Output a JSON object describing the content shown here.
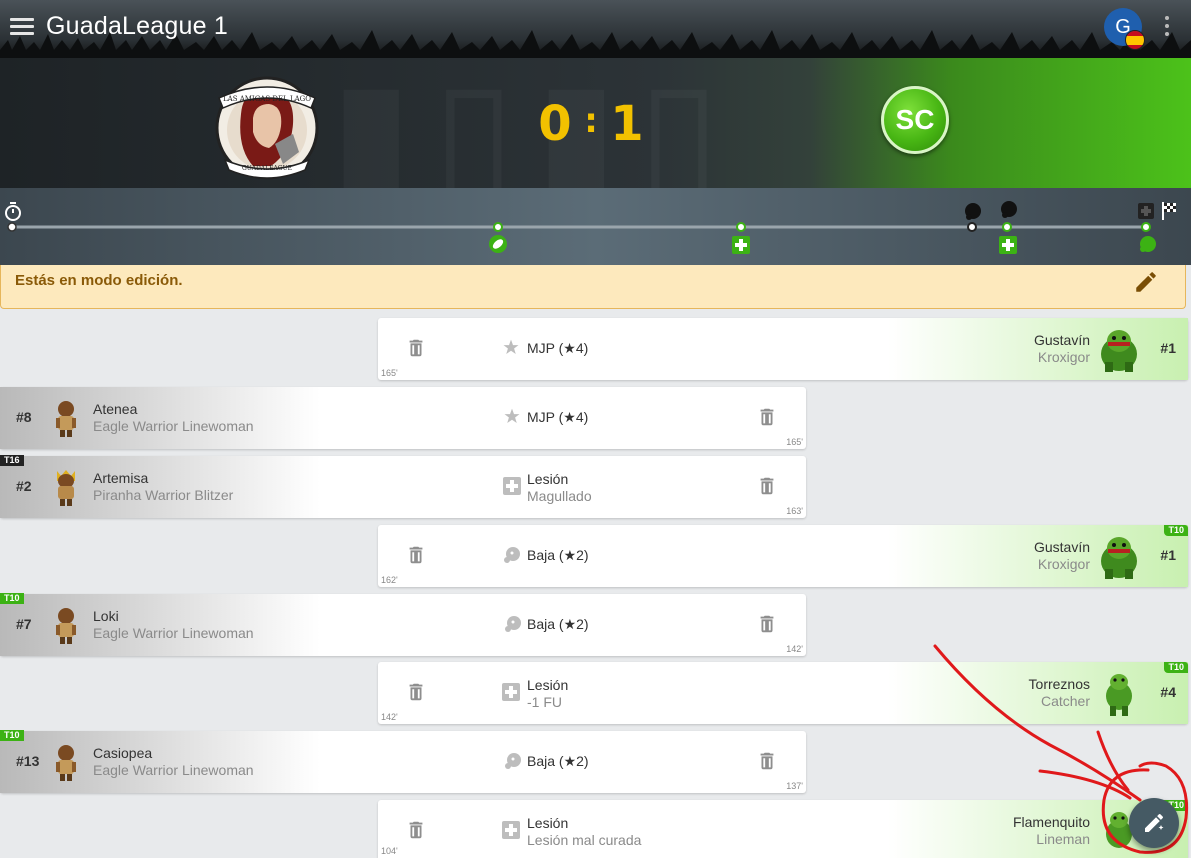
{
  "app": {
    "title": "GuadaLeague 1",
    "avatar_initial": "G"
  },
  "match": {
    "home_score": "0",
    "separator": ":",
    "away_score": "1",
    "home_logo_text_top": "LAS AMIGAS DEL LAGO",
    "home_logo_text_bottom": "GUADALEAGUE",
    "away_logo_text": "SC"
  },
  "edit_banner": {
    "text": "Estás en modo edición."
  },
  "events": [
    {
      "side": "away",
      "number": "#1",
      "name": "Gustavín",
      "role": "Kroxigor",
      "event": "MJP (★4)",
      "detail": "",
      "icon": "star-icon",
      "minute": "165'",
      "tag": ""
    },
    {
      "side": "home",
      "number": "#8",
      "name": "Atenea",
      "role": "Eagle Warrior Linewoman",
      "event": "MJP (★4)",
      "detail": "",
      "icon": "star-icon",
      "minute": "165'",
      "tag": ""
    },
    {
      "side": "home",
      "number": "#2",
      "name": "Artemisa",
      "role": "Piranha Warrior Blitzer",
      "event": "Lesión",
      "detail": "Magullado",
      "icon": "injury-cross-icon",
      "minute": "163'",
      "tag": "T16"
    },
    {
      "side": "away",
      "number": "#1",
      "name": "Gustavín",
      "role": "Kroxigor",
      "event": "Baja (★2)",
      "detail": "",
      "icon": "casualty-skull-icon",
      "minute": "162'",
      "tag": "T10"
    },
    {
      "side": "home",
      "number": "#7",
      "name": "Loki",
      "role": "Eagle Warrior Linewoman",
      "event": "Baja (★2)",
      "detail": "",
      "icon": "casualty-skull-icon",
      "minute": "142'",
      "tag": "T10"
    },
    {
      "side": "away",
      "number": "#4",
      "name": "Torreznos",
      "role": "Catcher",
      "event": "Lesión",
      "detail": "-1 FU",
      "icon": "injury-cross-icon",
      "minute": "142'",
      "tag": "T10"
    },
    {
      "side": "home",
      "number": "#13",
      "name": "Casiopea",
      "role": "Eagle Warrior Linewoman",
      "event": "Baja (★2)",
      "detail": "",
      "icon": "casualty-skull-icon",
      "minute": "137'",
      "tag": "T10"
    },
    {
      "side": "away",
      "number": "",
      "name": "Flamenquito",
      "role": "Lineman",
      "event": "Lesión",
      "detail": "Lesión mal curada",
      "icon": "injury-cross-icon",
      "minute": "104'",
      "tag": "T10"
    }
  ],
  "colors": {
    "away_team": "#4cc21a",
    "score": "#f2c100",
    "banner_bg": "#fde9bd",
    "banner_text": "#8a5a08",
    "fab": "#455a64",
    "annotation": "#e0191b"
  }
}
